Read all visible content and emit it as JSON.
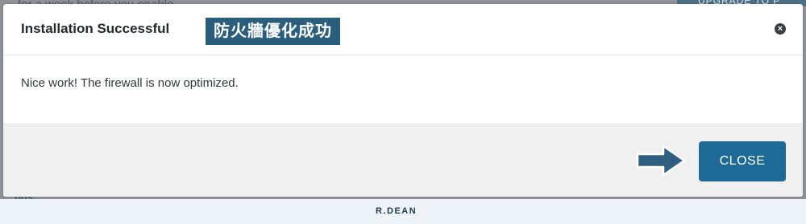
{
  "background": {
    "text_line": "for a week before you enable",
    "button_label": "UPGRADE TO P",
    "lower_text": "ngs"
  },
  "modal": {
    "title": "Installation Successful",
    "annotation": "防火牆優化成功",
    "close_icon": "×",
    "message": "Nice work! The firewall is now optimized.",
    "close_button_label": "CLOSE"
  },
  "watermark": {
    "brand": "R.DEAN"
  },
  "colors": {
    "primary_button": "#1d6a96",
    "annotation_bg": "#2b5d7d",
    "arrow": "#2e5e80",
    "footer_bg": "#f0f0f1"
  },
  "icons": {
    "pointer": "arrow-right-icon",
    "dismiss": "close-circle-icon"
  }
}
